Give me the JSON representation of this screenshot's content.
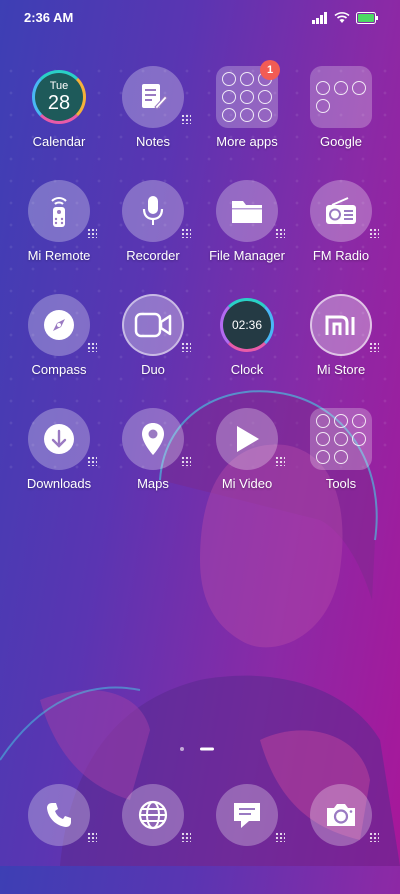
{
  "status": {
    "time": "2:36 AM"
  },
  "apps": [
    {
      "label": "Calendar",
      "icon": "calendar-icon",
      "day": "Tue",
      "date": "28"
    },
    {
      "label": "Notes",
      "icon": "notes-icon"
    },
    {
      "label": "More apps",
      "icon": "folder-icon",
      "badge": "1"
    },
    {
      "label": "Google",
      "icon": "folder-icon"
    },
    {
      "label": "Mi Remote",
      "icon": "remote-icon"
    },
    {
      "label": "Recorder",
      "icon": "microphone-icon"
    },
    {
      "label": "File Manager",
      "icon": "folder-file-icon"
    },
    {
      "label": "FM Radio",
      "icon": "radio-icon"
    },
    {
      "label": "Compass",
      "icon": "compass-icon"
    },
    {
      "label": "Duo",
      "icon": "video-camera-icon"
    },
    {
      "label": "Clock",
      "icon": "clock-icon",
      "time": "02:36"
    },
    {
      "label": "Mi Store",
      "icon": "mi-store-icon"
    },
    {
      "label": "Downloads",
      "icon": "download-icon"
    },
    {
      "label": "Maps",
      "icon": "map-pin-icon"
    },
    {
      "label": "Mi Video",
      "icon": "play-icon"
    },
    {
      "label": "Tools",
      "icon": "folder-icon"
    }
  ],
  "dock": [
    {
      "icon": "phone-icon"
    },
    {
      "icon": "globe-icon"
    },
    {
      "icon": "messages-icon"
    },
    {
      "icon": "camera-icon"
    }
  ]
}
